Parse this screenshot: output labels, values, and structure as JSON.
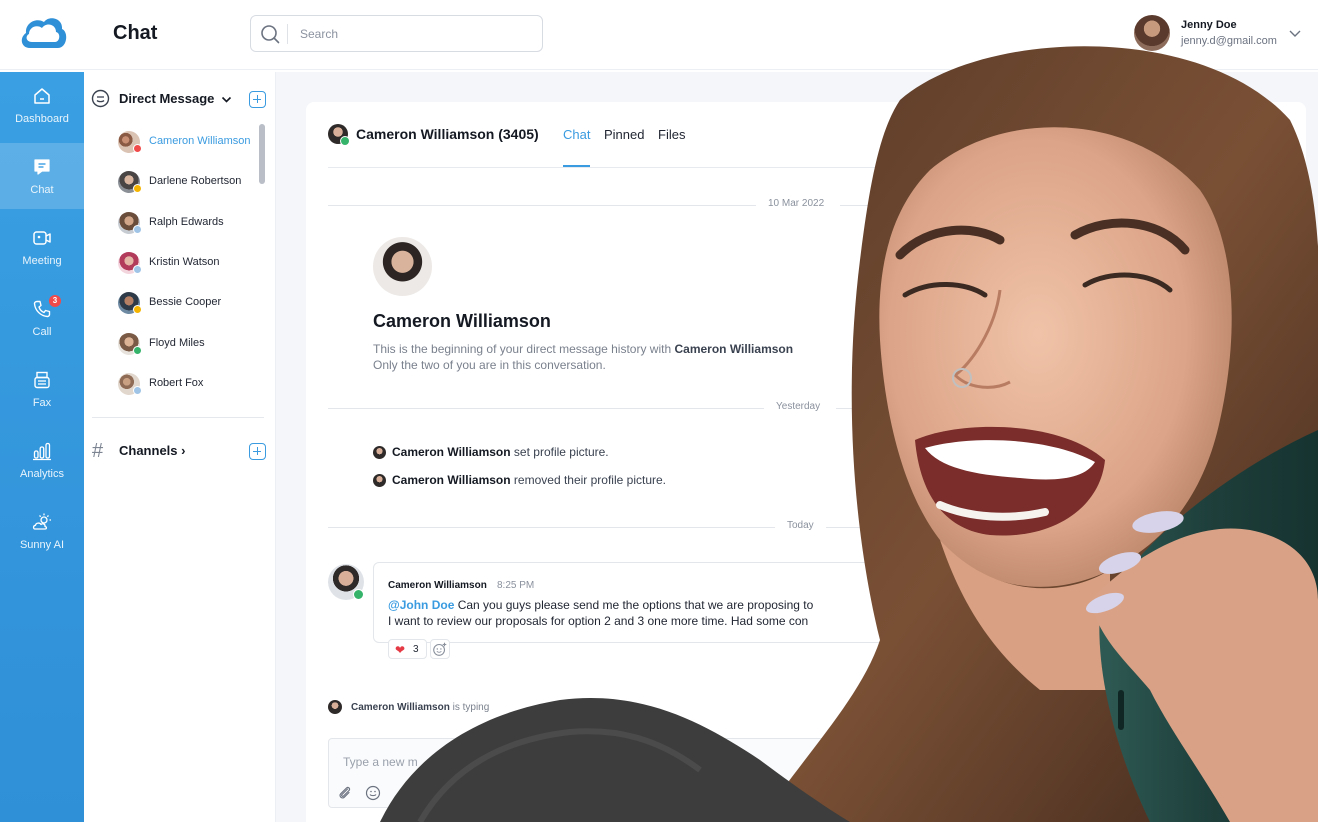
{
  "app": {
    "title": "Chat"
  },
  "search": {
    "placeholder": "Search"
  },
  "user": {
    "name": "Jenny Doe",
    "email": "jenny.d@gmail.com"
  },
  "rail": {
    "items": [
      {
        "label": "Dashboard",
        "icon": "home-icon"
      },
      {
        "label": "Chat",
        "icon": "chat-icon",
        "active": true
      },
      {
        "label": "Meeting",
        "icon": "video-icon"
      },
      {
        "label": "Call",
        "icon": "phone-icon",
        "badge": "3"
      },
      {
        "label": "Fax",
        "icon": "fax-icon"
      },
      {
        "label": "Analytics",
        "icon": "analytics-icon"
      },
      {
        "label": "Sunny AI",
        "icon": "sunny-ai-icon"
      }
    ]
  },
  "sidebar": {
    "direct_message_label": "Direct Message",
    "channels_label": "Channels",
    "contacts": [
      {
        "name": "Cameron Williamson",
        "status": "busy",
        "status_color": "#f04a4a"
      },
      {
        "name": "Darlene Robertson",
        "status": "away",
        "status_color": "#f5b400"
      },
      {
        "name": "Ralph Edwards",
        "status": "offline",
        "status_color": "#9fc4e6"
      },
      {
        "name": "Kristin Watson",
        "status": "offline",
        "status_color": "#9fc4e6"
      },
      {
        "name": "Bessie Cooper",
        "status": "away",
        "status_color": "#f5b400"
      },
      {
        "name": "Floyd Miles",
        "status": "online",
        "status_color": "#35b36a"
      },
      {
        "name": "Robert Fox",
        "status": "offline",
        "status_color": "#9fc4e6"
      }
    ]
  },
  "conversation": {
    "header": "Cameron Williamson (3405)",
    "tabs": [
      "Chat",
      "Pinned",
      "Files"
    ],
    "date_first": "10 Mar 2022",
    "intro_name": "Cameron Williamson",
    "intro_line1_prefix": "This is the beginning of your direct message history with ",
    "intro_line1_name": "Cameron Williamson",
    "intro_line2": "Only the two of you are in this conversation.",
    "date_yesterday": "Yesterday",
    "system_events": [
      {
        "name": "Cameron Williamson",
        "action": " set profile picture."
      },
      {
        "name": "Cameron Williamson",
        "action": " removed their profile picture."
      }
    ],
    "date_today": "Today",
    "message": {
      "author": "Cameron Williamson",
      "time": "8:25 PM",
      "mention": "@John Doe",
      "line1": " Can you guys please send me the options that we are proposing to",
      "line2": "I want to review our proposals for option 2 and 3 one more time. Had some con",
      "reaction_count": "3"
    },
    "typing_name": "Cameron Williamson",
    "typing_suffix": " is typing",
    "composer_placeholder": "Type a new m"
  },
  "colors": {
    "accent": "#3a9be0",
    "rail": "#3aa0e3",
    "online": "#35b36a",
    "badge": "#f04a4a"
  }
}
